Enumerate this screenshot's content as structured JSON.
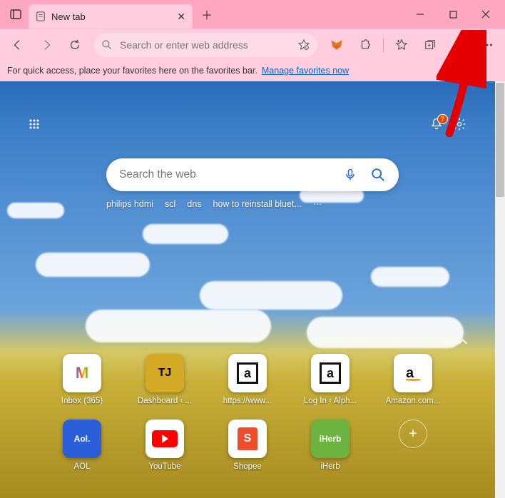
{
  "window": {
    "tab_title": "New tab",
    "controls": {
      "min": "—",
      "max": "▢",
      "close": "✕"
    }
  },
  "toolbar": {
    "address_placeholder": "Search or enter web address"
  },
  "favorites_bar": {
    "text": "For quick access, place your favorites here on the favorites bar.",
    "link": "Manage favorites now"
  },
  "ntp": {
    "notifications_badge": "7",
    "search_placeholder": "Search the web",
    "suggestions": [
      "philips hdmi",
      "scl",
      "dns",
      "how to reinstall bluet...",
      "···"
    ],
    "quicklinks_row1": [
      {
        "label": "Inbox (365)",
        "bg": "#ffffff",
        "text": "M",
        "color": "#d93025"
      },
      {
        "label": "Dashboard ‹ ...",
        "bg": "#d4a926",
        "text": "TJ",
        "color": "#000"
      },
      {
        "label": "https://www...",
        "bg": "#ffffff",
        "text": "a",
        "color": "#111",
        "boxed": true
      },
      {
        "label": "Log In ‹ Alph...",
        "bg": "#ffffff",
        "text": "a",
        "color": "#111",
        "boxed": true
      },
      {
        "label": "Amazon.com...",
        "bg": "#ffffff",
        "text": "a",
        "color": "#111"
      }
    ],
    "quicklinks_row2": [
      {
        "label": "AOL",
        "bg": "#2b5fd9",
        "text": "Aol.",
        "color": "#fff"
      },
      {
        "label": "YouTube",
        "bg": "#ffffff",
        "text": "▶",
        "color": "#f00"
      },
      {
        "label": "Shopee",
        "bg": "#ffffff",
        "text": "S",
        "color": "#ee4d2d"
      },
      {
        "label": "iHerb",
        "bg": "#6cb33f",
        "text": "iHerb",
        "color": "#fff"
      }
    ]
  }
}
